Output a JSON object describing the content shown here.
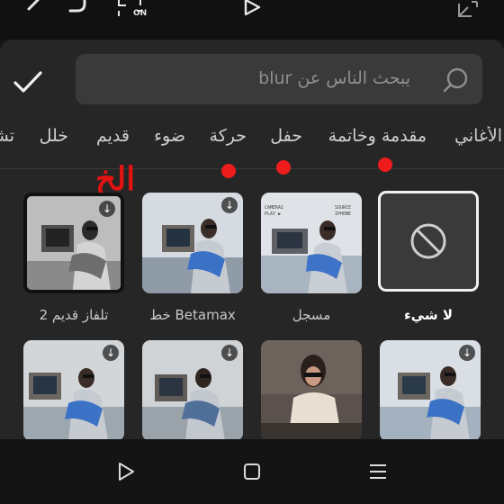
{
  "top_bar": {
    "icons": [
      "back-arrow-icon",
      "undo-icon",
      "crop-toggle-icon",
      "play-icon",
      "fullscreen-icon"
    ],
    "toggle_label": "ON"
  },
  "effects_panel": {
    "search": {
      "placeholder": "يبحث الناس عن blur"
    },
    "confirm_icon": "checkmark-icon",
    "tabs": [
      {
        "label": "الأغاني"
      },
      {
        "label": "مقدمة وخاتمة"
      },
      {
        "label": "حفل"
      },
      {
        "label": "حركة"
      },
      {
        "label": "ضوء"
      },
      {
        "label": "قديم"
      },
      {
        "label": "خلل"
      },
      {
        "label": "تشو"
      }
    ],
    "annotation": {
      "text": "الخ",
      "color": "#e21212"
    },
    "effects": [
      {
        "label": "لا شيء",
        "selected": true,
        "downloadable": false
      },
      {
        "label": "مسجل",
        "selected": false,
        "downloadable": false
      },
      {
        "label": "Betamax خط",
        "selected": false,
        "downloadable": true
      },
      {
        "label": "تلفاز قديم 2",
        "selected": false,
        "downloadable": true
      },
      {
        "label": "",
        "selected": false,
        "downloadable": true
      },
      {
        "label": "",
        "selected": false,
        "downloadable": false
      },
      {
        "label": "",
        "selected": false,
        "downloadable": true
      },
      {
        "label": "",
        "selected": false,
        "downloadable": true
      }
    ],
    "overlay_text": "CAMERA1 PLAY\nSOURCE IPHONE"
  },
  "nav_bar": {
    "icons": [
      "back-triangle-icon",
      "home-square-icon",
      "recents-lines-icon"
    ]
  },
  "colors": {
    "annotation_red": "#ee1c1c",
    "panel_bg": "#262626",
    "selected_border": "#f0f0f0"
  }
}
